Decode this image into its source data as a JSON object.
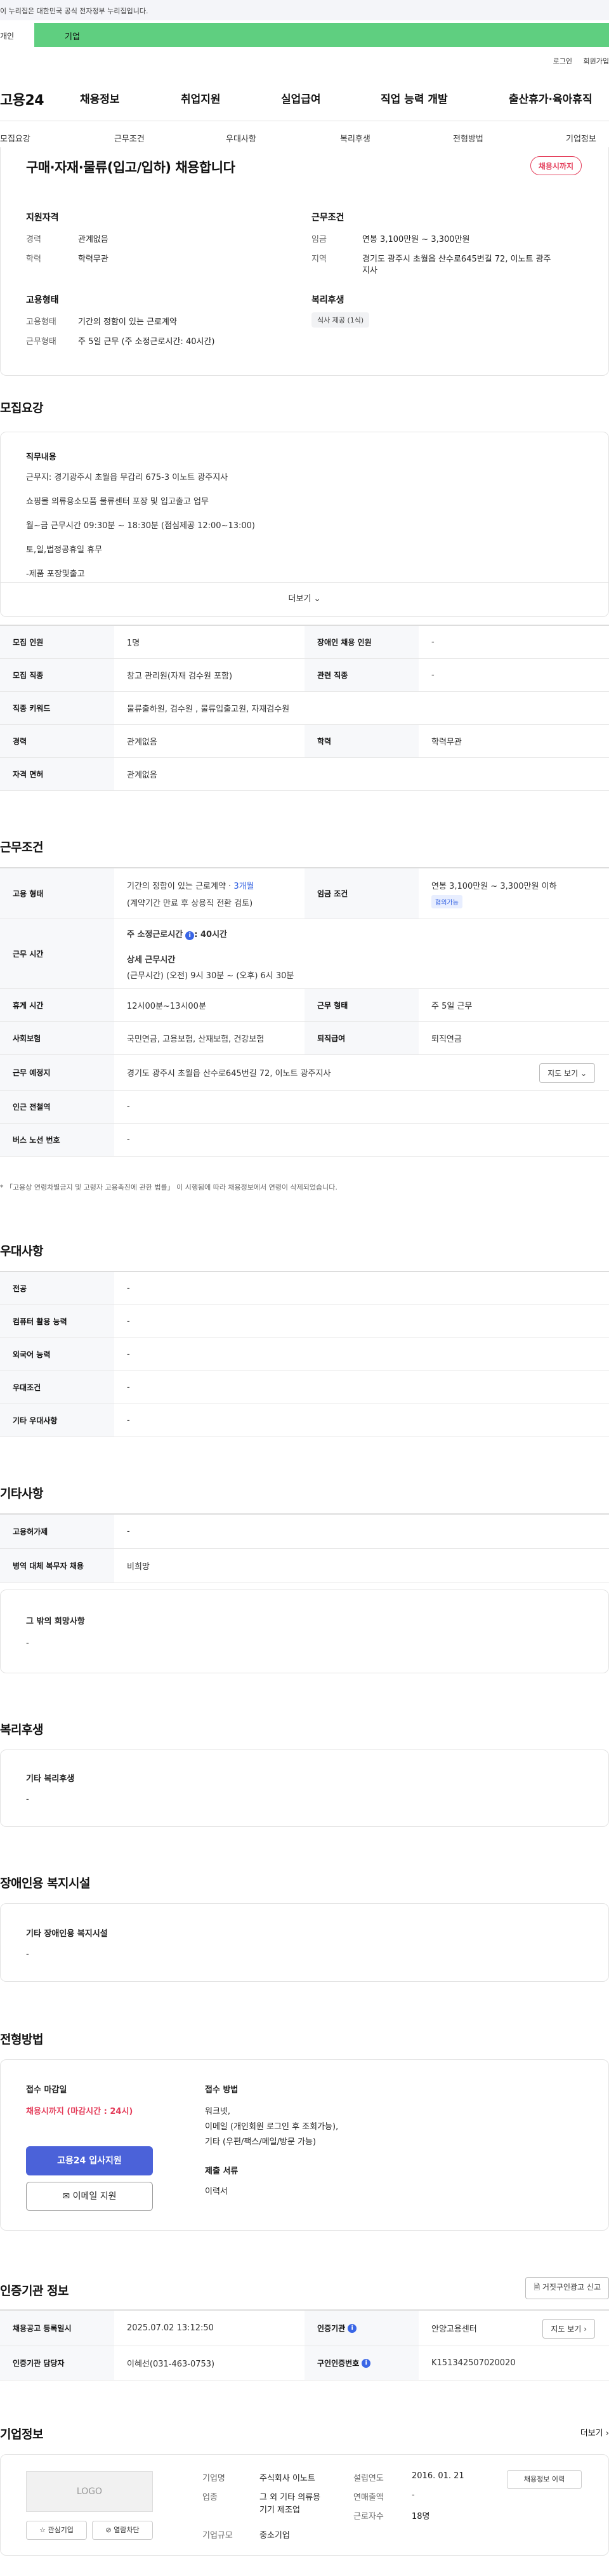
{
  "gov_banner": "이 누리집은 대한민국 공식 전자정부 누리집입니다.",
  "top_tabs": {
    "individual": "개인",
    "business": "기업"
  },
  "util": {
    "login": "로그인",
    "signup": "회원가입"
  },
  "gnb": {
    "logo": "고용24",
    "items": [
      "채용정보",
      "취업지원",
      "실업급여",
      "직업 능력 개발",
      "출산휴가·육아휴직"
    ]
  },
  "anchors": [
    "모집요강",
    "근무조건",
    "우대사항",
    "복리후생",
    "전형방법",
    "기업정보"
  ],
  "summary": {
    "title": "구매·자재·물류(입고/입하) 채용합니다",
    "deadline_badge": "채용시까지",
    "qualification_title": "지원자격",
    "experience_label": "경력",
    "experience_value": "관계없음",
    "education_label": "학력",
    "education_value": "학력무관",
    "conditions_title": "근무조건",
    "wage_label": "임금",
    "wage_value": "연봉 3,100만원 ~ 3,300만원",
    "area_label": "지역",
    "area_value_1": "경기도 광주시 초월읍 산수로645번길 72, 이노트 광주",
    "area_value_2": "지사",
    "employment_title": "고용형태",
    "employment_label": "고용형태",
    "employment_value": "기간의 정함이 있는 근로계약",
    "work_label": "근무형태",
    "work_value": "주 5일 근무 (주 소정근로시간: 40시간)",
    "welfare_title": "복리후생",
    "welfare_chip": "식사 제공 (1식)"
  },
  "recruit": {
    "section_title": "모집요강",
    "duty_title": "직무내용",
    "duty_lines": [
      "근무지: 경기광주시 초월읍 무갑리 675-3 이노트 광주지사",
      "쇼핑몰 의류용소모품 물류센터 포장 및 입고출고 업무",
      "월~금 근무시간 09:30분 ~ 18:30분 (점심제공 12:00~13:00)",
      "토,일,법정공휴일 휴무",
      "-제품 포장및출고"
    ],
    "more": "더보기",
    "rows": [
      {
        "k1": "모집 인원",
        "v1": "1명",
        "k2": "장애인 채용 인원",
        "v2": "-"
      },
      {
        "k1": "모집 직종",
        "v1": "창고 관리원(자재 검수원 포함)",
        "k2": "관련 직종",
        "v2": "-"
      },
      {
        "k1": "직종 키워드",
        "v1": "물류출하원, 검수원 , 물류입출고원, 자재검수원"
      },
      {
        "k1": "경력",
        "v1": "관계없음",
        "k2": "학력",
        "v2": "학력무관"
      },
      {
        "k1": "자격 면허",
        "v1": "관계없음"
      }
    ]
  },
  "conditions": {
    "section_title": "근무조건",
    "employment_k": "고용 형태",
    "employment_v1_pre": "기간의 정함이 있는 근로계약 · ",
    "employment_v1_blue": "3개월",
    "employment_v2": "(계약기간 만료 후 상용직 전환 검토)",
    "wage_k": "임금 조건",
    "wage_v": "연봉 3,100만원 ~ 3,300만원 이하",
    "wage_tag": "협의가능",
    "hours_k": "근무 시간",
    "hours_main_label": "주 소정근로시간",
    "hours_main_value": ": 40시간",
    "hours_detail_title": "상세 근무시간",
    "hours_detail_value": "(근무시간) (오전) 9시 30분 ~ (오후) 6시 30분",
    "rows": [
      {
        "k1": "휴게 시간",
        "v1": "12시00분~13시00분",
        "k2": "근무 형태",
        "v2": "주 5일 근무"
      },
      {
        "k1": "사회보험",
        "v1": "국민연금, 고용보험, 산재보험, 건강보험",
        "k2": "퇴직급여",
        "v2": "퇴직연금"
      }
    ],
    "place_k": "근무 예정지",
    "place_v": "경기도 광주시 초월읍 산수로645번길 72, 이노트 광주지사",
    "map_button": "지도 보기",
    "station_k": "인근 전철역",
    "station_v": "-",
    "bus_k": "버스 노선 번호",
    "bus_v": "-",
    "footnote": "* 「고용상 연령차별금지 및 고령자 고용촉진에 관한 법률」 이 시행됨에 따라 채용정보에서 연령이 삭제되었습니다."
  },
  "preference": {
    "section_title": "우대사항",
    "rows": [
      {
        "k": "전공",
        "v": "-"
      },
      {
        "k": "컴퓨터 활용 능력",
        "v": "-"
      },
      {
        "k": "외국어 능력",
        "v": "-"
      },
      {
        "k": "우대조건",
        "v": "-"
      },
      {
        "k": "기타 우대사항",
        "v": "-"
      }
    ]
  },
  "etc": {
    "section_title": "기타사항",
    "rows": [
      {
        "k": "고용허가제",
        "v": "-"
      },
      {
        "k": "병역 대체 복무자 채용",
        "v": "비희망"
      }
    ],
    "other_title": "그 밖의 희망사항",
    "other_value": "-"
  },
  "welfare": {
    "section_title": "복리후생",
    "box_title": "기타 복리후생",
    "box_value": "-"
  },
  "facility": {
    "section_title": "장애인용 복지시설",
    "box_title": "기타 장애인용 복지시설",
    "box_value": "-"
  },
  "selection": {
    "section_title": "전형방법",
    "deadline_title": "접수 마감일",
    "deadline_value": "채용시까지 (마감시간 : 24시)",
    "apply_button": "고용24 입사지원",
    "email_button": "이메일 지원",
    "method_title": "접수 방법",
    "method_lines": [
      "워크넷,",
      "이메일 (개인회원 로그인 후 조회가능),",
      "기타 (우편/팩스/메일/방문 가능)"
    ],
    "docs_title": "제출 서류",
    "docs_value": "이력서"
  },
  "cert": {
    "section_title": "인증기관 정보",
    "report_button": "거짓구인광고 신고",
    "rows": [
      {
        "k1": "채용공고 등록일시",
        "v1": "2025.07.02 13:12:50",
        "k2": "인증기관",
        "v2": "안양고용센터",
        "btn": "지도 보기"
      },
      {
        "k1": "인증기관 담당자",
        "v1": "이혜선(031-463-0753)",
        "k2": "구인인증번호",
        "v2": "K151342507020020"
      }
    ]
  },
  "company": {
    "section_title": "기업정보",
    "more": "더보기",
    "logo_text": "LOGO",
    "fav_button": "관심기업",
    "block_button": "열람차단",
    "name_k": "기업명",
    "name_v": "주식회사 이노트",
    "industry_k": "업종",
    "industry_v1": "그 외 기타 의류용",
    "industry_v2": "기기 제조업",
    "size_k": "기업규모",
    "size_v": "중소기업",
    "founded_k": "설립연도",
    "founded_v": "2016. 01. 21",
    "sales_k": "연매출액",
    "sales_v": "-",
    "employees_k": "근로자수",
    "employees_v": "18명",
    "jobs_button": "채용정보 이력"
  }
}
